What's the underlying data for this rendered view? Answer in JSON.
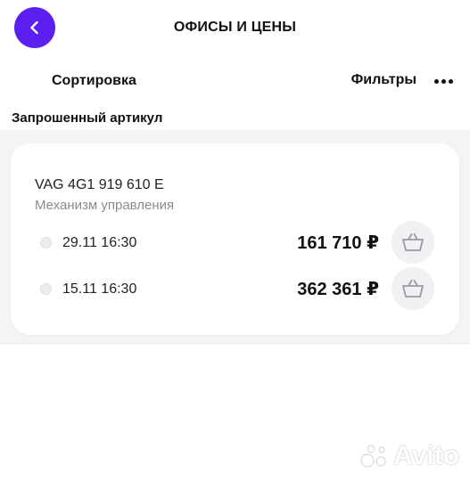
{
  "header": {
    "title": "ОФИСЫ И ЦЕНЫ",
    "back_icon": "chevron-left-icon",
    "accent_color": "#5b1ff0"
  },
  "toolbar": {
    "sort_label": "Сортировка",
    "filters_label": "Фильтры",
    "more_icon": "more-horizontal-icon"
  },
  "section": {
    "title": "Запрошенный артикул"
  },
  "part": {
    "number": "VAG 4G1 919 610 E",
    "name": "Механизм управления"
  },
  "offers": [
    {
      "date": "29.11 16:30",
      "price": "161 710 ₽",
      "cart_icon": "basket-icon"
    },
    {
      "date": "15.11 16:30",
      "price": "362 361 ₽",
      "cart_icon": "basket-icon"
    }
  ],
  "watermark": {
    "text": "Avito"
  }
}
